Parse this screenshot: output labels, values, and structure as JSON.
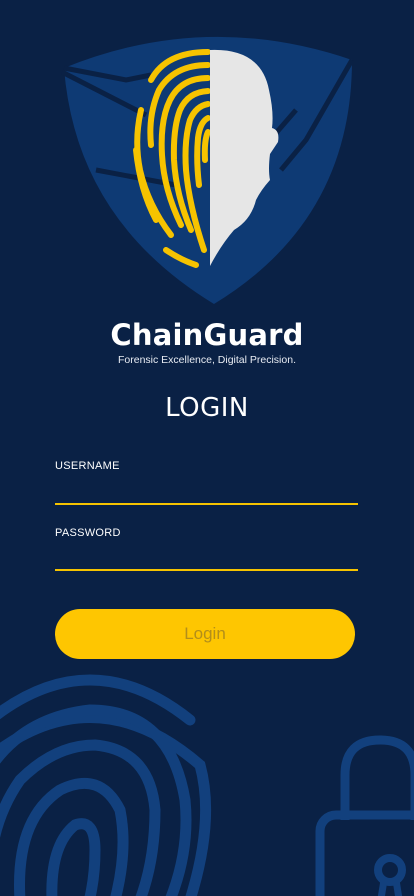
{
  "app": {
    "brand_name": "ChainGuard",
    "tagline": "Forensic Excellence, Digital Precision."
  },
  "login": {
    "title": "LOGIN",
    "username_label": "USERNAME",
    "username_value": "",
    "password_label": "PASSWORD",
    "password_value": "",
    "button_label": "Login"
  },
  "icons": {
    "logo": "shield-fingerprint-face-logo",
    "background_left": "fingerprint-icon",
    "background_right": "padlock-icon"
  },
  "colors": {
    "background": "#0a2145",
    "shield": "#0e3a74",
    "accent": "#fec601",
    "button_text": "#b38e1a",
    "face": "#e6e6e6",
    "decor": "#12407d"
  }
}
